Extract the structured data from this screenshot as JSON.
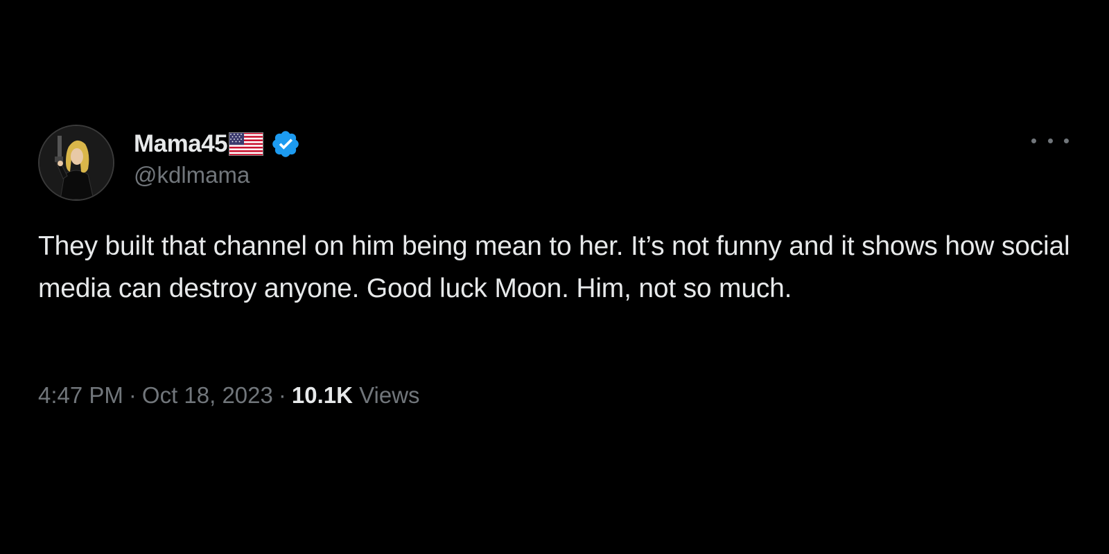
{
  "tweet": {
    "author": {
      "display_name": "Mama45",
      "flag_icon": "us-flag-icon",
      "verified_icon": "verified-badge-icon",
      "handle": "@kdlmama"
    },
    "more_icon": "more-options-icon",
    "text": "They built that channel on him being mean to her. It’s not funny and it shows how social media can destroy anyone. Good luck Moon. Him, not so much.",
    "time": "4:47 PM",
    "separator": "·",
    "date": "Oct 18, 2023",
    "views_count": "10.1K",
    "views_label": "Views"
  },
  "colors": {
    "background": "#000000",
    "primary_text": "#e7e9ea",
    "secondary_text": "#71767b",
    "verified_blue": "#1d9bf0"
  }
}
